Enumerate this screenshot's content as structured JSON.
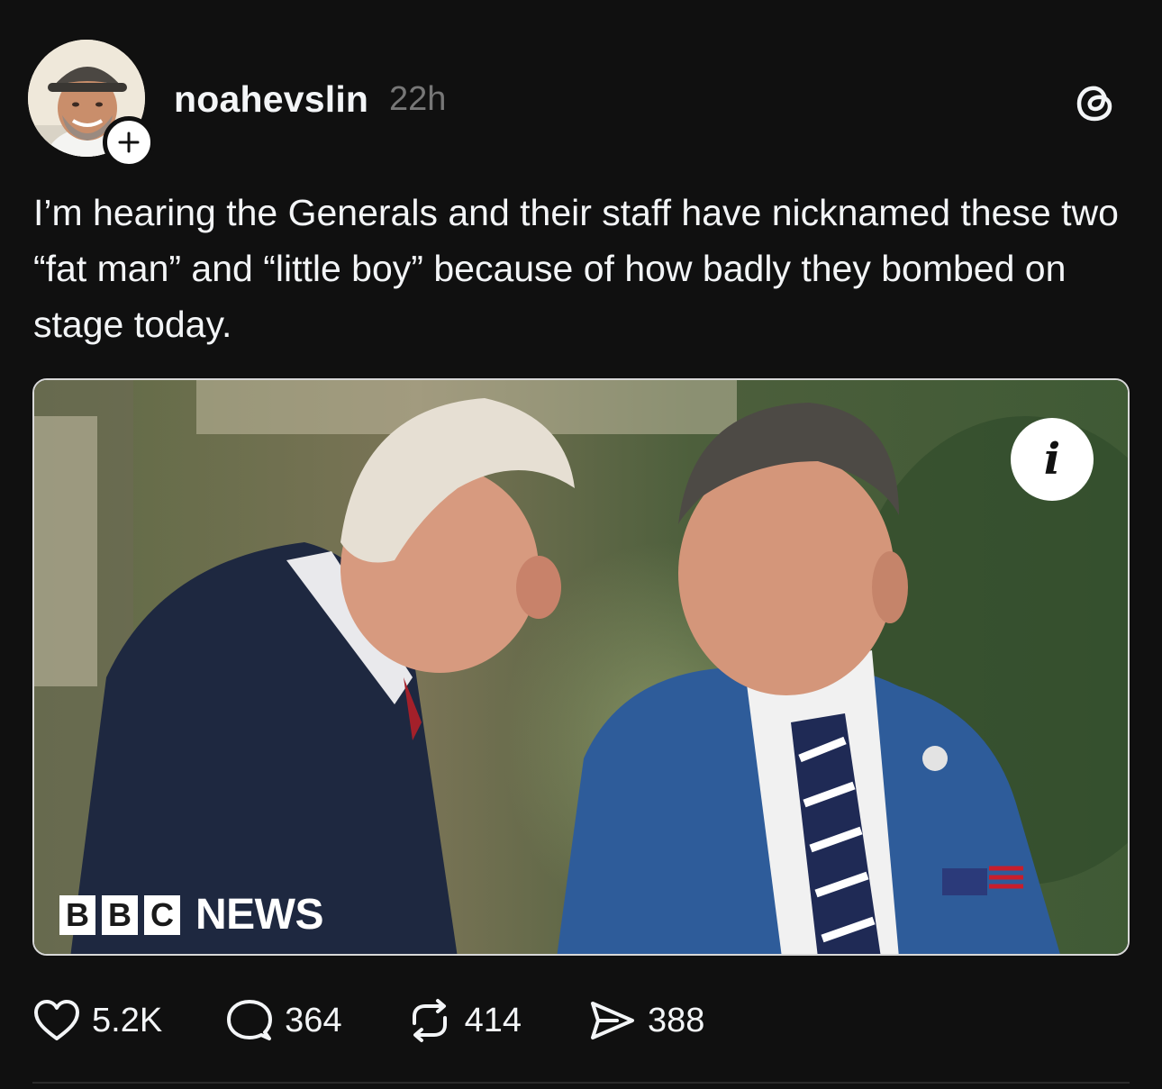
{
  "post": {
    "username": "noahevslin",
    "timestamp": "22h",
    "text": "I’m hearing the Generals and their staff have nicknamed these two “fat man” and “little boy” because of how badly they bombed on stage today.",
    "media": {
      "watermark_letters": [
        "B",
        "B",
        "C"
      ],
      "watermark_word": "NEWS",
      "info_glyph": "i"
    },
    "actions": {
      "likes": "5.2K",
      "replies": "364",
      "reposts": "414",
      "shares": "388"
    }
  },
  "icons": {
    "follow": "plus-icon",
    "app": "threads-logo-icon",
    "like": "heart-icon",
    "reply": "speech-bubble-icon",
    "repost": "repost-arrows-icon",
    "share": "paper-plane-icon"
  },
  "colors": {
    "background": "#101010",
    "text": "#f3f5f7",
    "muted": "#777777"
  }
}
